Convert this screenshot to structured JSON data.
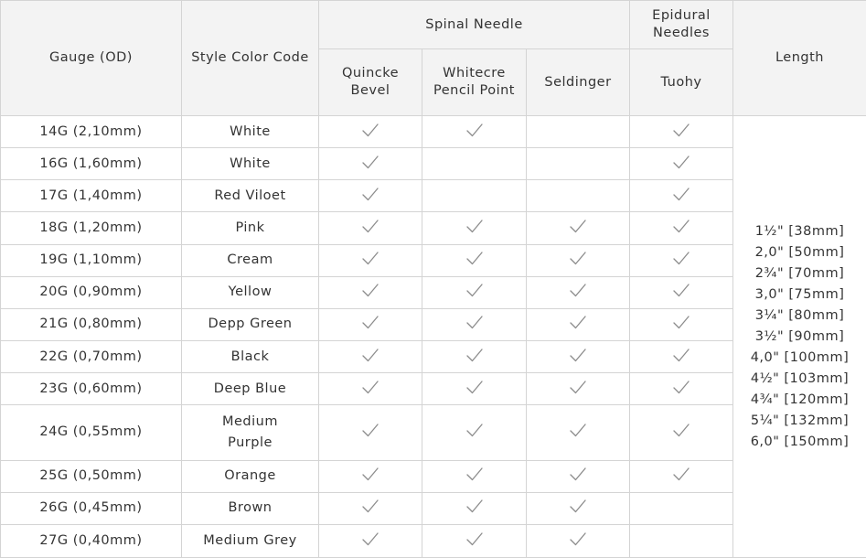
{
  "headers": {
    "gauge": "Gauge (OD)",
    "color_code": "Style Color Code",
    "spinal_needle": "Spinal Needle",
    "epidural_needles": "Epidural Needles",
    "length": "Length",
    "quincke": "Quincke Bevel",
    "whitecre": "Whitecre Pencil Point",
    "seldinger": "Seldinger",
    "tuohy": "Tuohy"
  },
  "check_icon": "check-icon",
  "colors": {
    "border": "#d4d4d4",
    "header_bg": "#f3f3f3",
    "text": "#333333",
    "check": "#8c8c8c"
  },
  "rows": [
    {
      "gauge": "14G (2,10mm)",
      "color": "White",
      "quincke": true,
      "whitecre": true,
      "seldinger": false,
      "tuohy": true
    },
    {
      "gauge": "16G (1,60mm)",
      "color": "White",
      "quincke": true,
      "whitecre": false,
      "seldinger": false,
      "tuohy": true
    },
    {
      "gauge": "17G (1,40mm)",
      "color": "Red Viloet",
      "quincke": true,
      "whitecre": false,
      "seldinger": false,
      "tuohy": true
    },
    {
      "gauge": "18G (1,20mm)",
      "color": "Pink",
      "quincke": true,
      "whitecre": true,
      "seldinger": true,
      "tuohy": true
    },
    {
      "gauge": "19G (1,10mm)",
      "color": "Cream",
      "quincke": true,
      "whitecre": true,
      "seldinger": true,
      "tuohy": true
    },
    {
      "gauge": "20G (0,90mm)",
      "color": "Yellow",
      "quincke": true,
      "whitecre": true,
      "seldinger": true,
      "tuohy": true
    },
    {
      "gauge": "21G (0,80mm)",
      "color": "Depp Green",
      "quincke": true,
      "whitecre": true,
      "seldinger": true,
      "tuohy": true
    },
    {
      "gauge": "22G (0,70mm)",
      "color": "Black",
      "quincke": true,
      "whitecre": true,
      "seldinger": true,
      "tuohy": true
    },
    {
      "gauge": "23G (0,60mm)",
      "color": "Deep Blue",
      "quincke": true,
      "whitecre": true,
      "seldinger": true,
      "tuohy": true
    },
    {
      "gauge": "24G (0,55mm)",
      "color": "Medium Purple",
      "quincke": true,
      "whitecre": true,
      "seldinger": true,
      "tuohy": true
    },
    {
      "gauge": "25G (0,50mm)",
      "color": "Orange",
      "quincke": true,
      "whitecre": true,
      "seldinger": true,
      "tuohy": true
    },
    {
      "gauge": "26G (0,45mm)",
      "color": "Brown",
      "quincke": true,
      "whitecre": true,
      "seldinger": true,
      "tuohy": false
    },
    {
      "gauge": "27G (0,40mm)",
      "color": "Medium Grey",
      "quincke": true,
      "whitecre": true,
      "seldinger": true,
      "tuohy": false
    }
  ],
  "lengths": [
    "1½\" [38mm]",
    "2,0\" [50mm]",
    "2¾\" [70mm]",
    "3,0\" [75mm]",
    "3¼\" [80mm]",
    "3½\" [90mm]",
    "4,0\" [100mm]",
    "4½\" [103mm]",
    "4¾\" [120mm]",
    "5¼\" [132mm]",
    "6,0\" [150mm]"
  ]
}
